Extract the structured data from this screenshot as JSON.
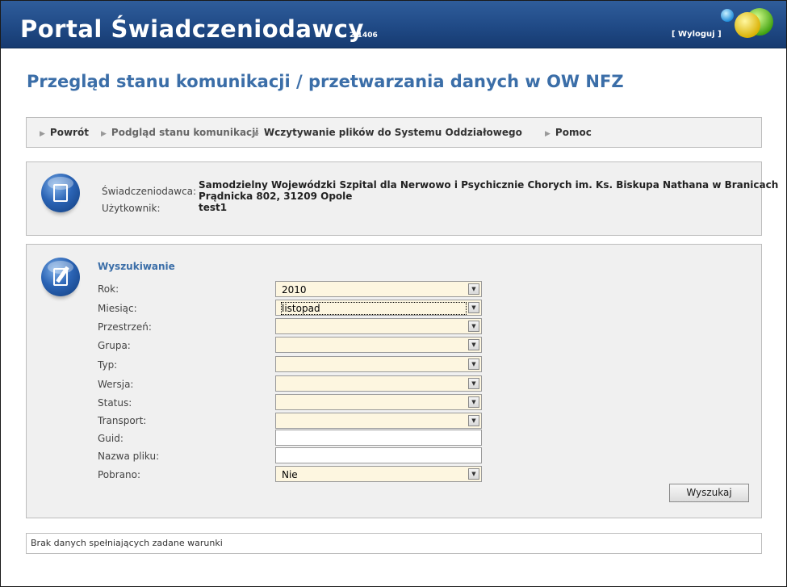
{
  "header": {
    "title": "Portal Świadczeniodawcy",
    "version": "2.1406",
    "logout": "[ Wyloguj ]"
  },
  "page_title": "Przegląd stanu komunikacji / przetwarzania danych w OW NFZ",
  "nav": {
    "items": [
      {
        "label": "Powrót"
      },
      {
        "label": "Podgląd stanu komunikacji"
      },
      {
        "label": "Wczytywanie plików do Systemu Oddziałowego"
      },
      {
        "label": "Pomoc"
      }
    ]
  },
  "info": {
    "provider_label": "Świadczeniodawca:",
    "provider_name": "Samodzielny Wojewódzki Szpital dla Nerwowo i Psychicznie Chorych im. Ks. Biskupa Nathana w Branicach",
    "provider_address": "Prądnicka 802, 31209 Opole",
    "user_label": "Użytkownik:",
    "user_value": "test1"
  },
  "search": {
    "title": "Wyszukiwanie",
    "fields": {
      "rok": {
        "label": "Rok:",
        "value": "2010"
      },
      "miesiac": {
        "label": "Miesiąc:",
        "value": "listopad"
      },
      "przestrzen": {
        "label": "Przestrzeń:",
        "value": ""
      },
      "grupa": {
        "label": "Grupa:",
        "value": ""
      },
      "typ": {
        "label": "Typ:",
        "value": ""
      },
      "wersja": {
        "label": "Wersja:",
        "value": ""
      },
      "status": {
        "label": "Status:",
        "value": ""
      },
      "transport": {
        "label": "Transport:",
        "value": ""
      },
      "guid": {
        "label": "Guid:",
        "value": ""
      },
      "nazwa_pliku": {
        "label": "Nazwa pliku:",
        "value": ""
      },
      "pobrano": {
        "label": "Pobrano:",
        "value": "Nie"
      }
    },
    "button": "Wyszukaj"
  },
  "message": "Brak danych spełniających zadane warunki",
  "colors": {
    "header_bg": "#204a86",
    "title_blue": "#3b6ea8",
    "select_bg": "#fdf6e0",
    "panel_bg": "#f0f0f0"
  }
}
